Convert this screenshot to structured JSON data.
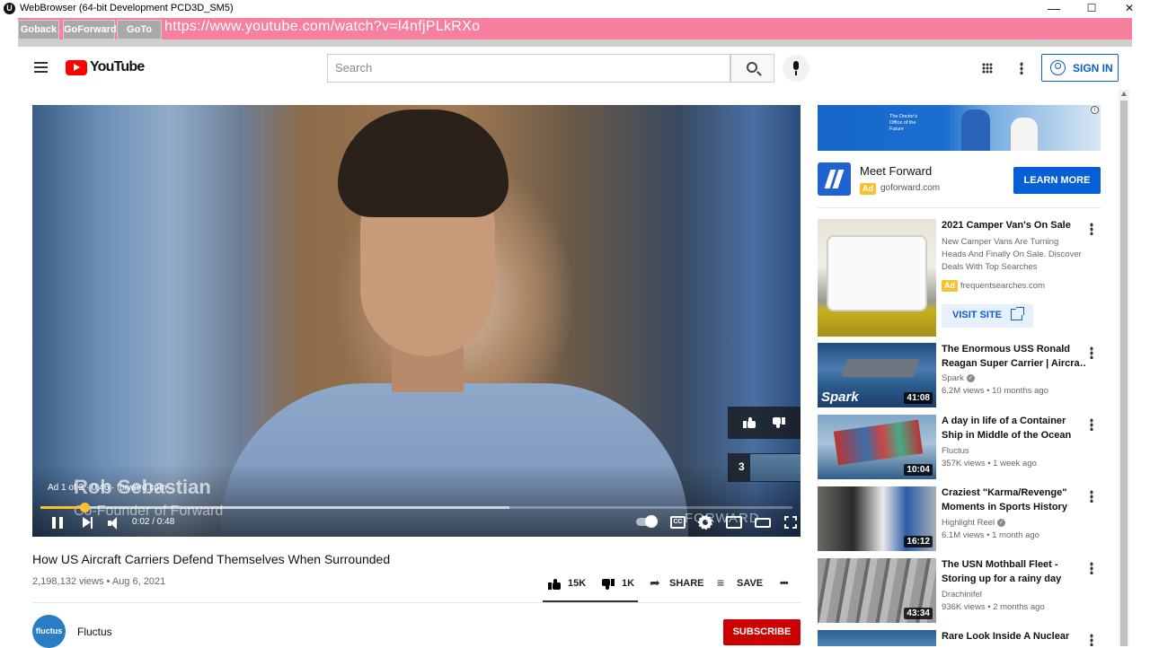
{
  "window": {
    "title": "WebBrowser (64-bit Development PCD3D_SM5)",
    "app_badge": "U",
    "minimize": "—",
    "maximize": "☐",
    "close": "✕"
  },
  "browser_nav": {
    "goback": "Goback",
    "goforward": "GoForward",
    "goto": "GoTo",
    "url": "https://www.youtube.com/watch?v=l4nfjPLkRXo"
  },
  "header": {
    "logo_text": "YouTube",
    "search_placeholder": "Search",
    "signin_label": "SIGN IN"
  },
  "player": {
    "lower_third_name": "Rob Sebastian",
    "lower_third_role": "Co-Founder of Forward",
    "ad_info": "Ad 1 of 2 · 0:46 · forward.com",
    "watermark": "FORWARD",
    "time_current": "0:02",
    "time_total": "0:48",
    "time_display": "0:02 / 0:48",
    "progress_fraction": 0.058,
    "buffered_fraction": 0.624,
    "next_ad_countdown": "3"
  },
  "video": {
    "title": "How US Aircraft Carriers Defend Themselves When Surrounded",
    "meta": "2,198,132 views • Aug 6, 2021",
    "likes": "15K",
    "dislikes": "1K",
    "share_label": "SHARE",
    "save_label": "SAVE",
    "more_label": "•••"
  },
  "channel": {
    "name": "Fluctus",
    "avatar_text": "fluctus",
    "subscribe_label": "SUBSCRIBE"
  },
  "side_ad": {
    "banner_tagline": "The Doctor's Office of the Future",
    "name": "Meet Forward",
    "badge": "Ad",
    "domain": "goforward.com",
    "cta": "LEARN MORE",
    "info_icon": "i"
  },
  "promo": {
    "title": "2021 Camper Van's On Sale",
    "description": "New Camper Vans Are Turning Heads And Finally On Sale. Discover Deals With Top Searches",
    "badge": "Ad",
    "domain": "frequentsearches.com",
    "cta": "VISIT SITE"
  },
  "related": [
    {
      "title1": "The Enormous USS Ronald",
      "title2": "Reagan Super Carrier | Aircra…",
      "channel": "Spark",
      "verified": true,
      "meta": "6.2M views • 10 months ago",
      "duration": "41:08",
      "thumb_label": "Spark"
    },
    {
      "title1": "A day in life of a Container",
      "title2": "Ship in Middle of the Ocean",
      "channel": "Fluctus",
      "verified": false,
      "meta": "357K views • 1 week ago",
      "duration": "10:04"
    },
    {
      "title1": "Craziest \"Karma/Revenge\"",
      "title2": "Moments in Sports History",
      "channel": "Highlight Reel",
      "verified": true,
      "meta": "6.1M views • 1 month ago",
      "duration": "16:12"
    },
    {
      "title1": "The USN Mothball Fleet -",
      "title2": "Storing up for a rainy day",
      "channel": "Drachinifel",
      "verified": false,
      "meta": "936K views • 2 months ago",
      "duration": "43:34"
    },
    {
      "title1": "Rare Look Inside A Nuclear",
      "title2": "",
      "channel": "",
      "verified": false,
      "meta": "",
      "duration": ""
    }
  ],
  "colors": {
    "nav_bar": "#f6809e",
    "brand_red": "#ff0000",
    "link_blue": "#065fd4",
    "progress_yellow": "#fbc02d",
    "ad_badge": "#f9c132"
  }
}
